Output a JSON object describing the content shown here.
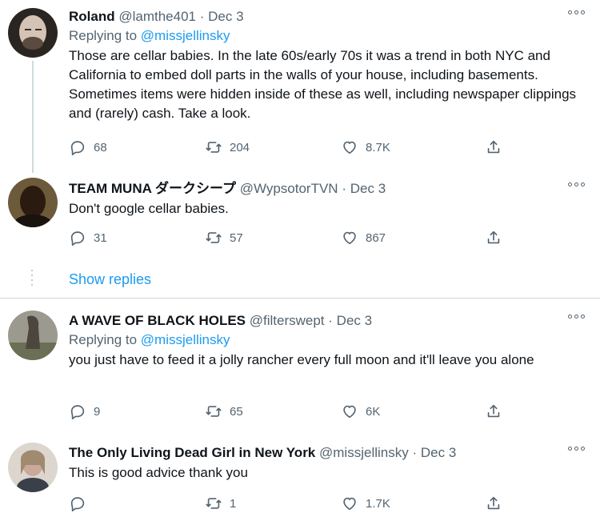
{
  "tweets": [
    {
      "name": "Roland",
      "handle": "@lamthe401",
      "sep": "·",
      "date": "Dec 3",
      "replying_prefix": "Replying to",
      "replying_to": "@missjellinsky",
      "text": "Those are cellar babies. In the late 60s/early 70s it was a trend in both NYC and California to embed doll parts in the walls of your house, including basements. Sometimes items were hidden inside of these as well, including newspaper clippings and (rarely) cash. Take a look.",
      "replies": "68",
      "retweets": "204",
      "likes": "8.7K",
      "avatar_color": "#5a4f49"
    },
    {
      "name": "TEAM MUNA ダークシープ",
      "handle": "@WypsotorTVN",
      "sep": "·",
      "date": "Dec 3",
      "text": "Don't google cellar babies.",
      "replies": "31",
      "retweets": "57",
      "likes": "867",
      "avatar_color": "#3a2a1c"
    },
    {
      "name": "A WAVE OF BLACK HOLES",
      "handle": "@filterswept",
      "sep": "·",
      "date": "Dec 3",
      "replying_prefix": "Replying to",
      "replying_to": "@missjellinsky",
      "text": "you just have to feed it a jolly rancher every full moon and it'll leave you alone",
      "replies": "9",
      "retweets": "65",
      "likes": "6K",
      "avatar_color": "#7a7a6e"
    },
    {
      "name": "The Only Living Dead Girl in New York",
      "handle": "@missjellinsky",
      "sep": "·",
      "date": "Dec 3",
      "text": "This is good advice thank you",
      "replies": "",
      "retweets": "1",
      "likes": "1.7K",
      "avatar_color": "#a79a8c"
    }
  ],
  "show_replies": "Show replies",
  "colors": {
    "accent": "#1d9bf0",
    "muted": "#536471",
    "divider": "#cfd9de"
  }
}
